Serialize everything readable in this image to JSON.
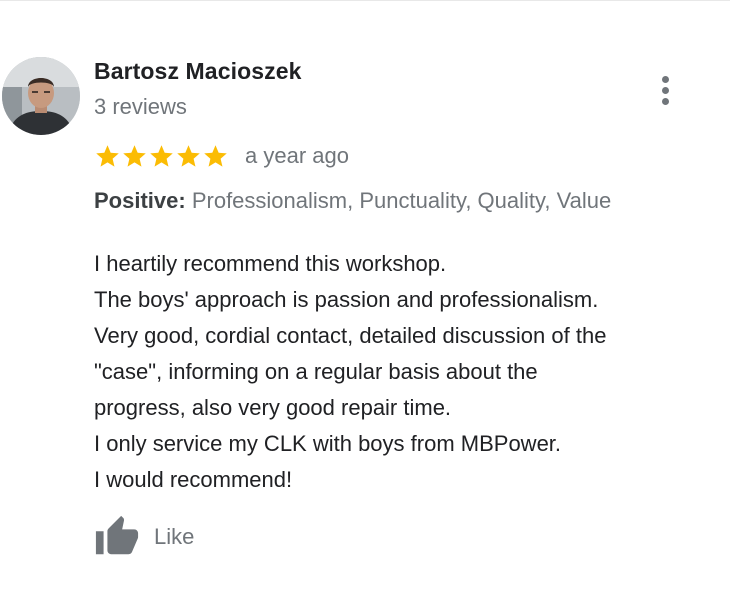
{
  "review": {
    "author_name": "Bartosz Macioszek",
    "author_review_count": "3 reviews",
    "rating": 5,
    "rating_max": 5,
    "date": "a year ago",
    "attributes_label": "Positive:",
    "attributes_values": "Professionalism, Punctuality, Quality, Value",
    "text_lines": [
      "I heartily recommend this workshop.",
      "The boys' approach is passion and professionalism.",
      "Very good, cordial contact, detailed discussion of the",
      "\"case\", informing on a regular basis about the",
      "progress, also very good repair time.",
      "I only service my CLK with boys from MBPower.",
      "I would recommend!"
    ],
    "like_label": "Like"
  },
  "icons": {
    "more": "more-vert-icon",
    "star": "star-icon",
    "like": "thumb-up-icon",
    "avatar": "user-avatar-photo"
  },
  "colors": {
    "star": "#fbbc04",
    "secondary_text": "#70757a",
    "primary_text": "#202124",
    "icon_gray": "#70757a"
  }
}
